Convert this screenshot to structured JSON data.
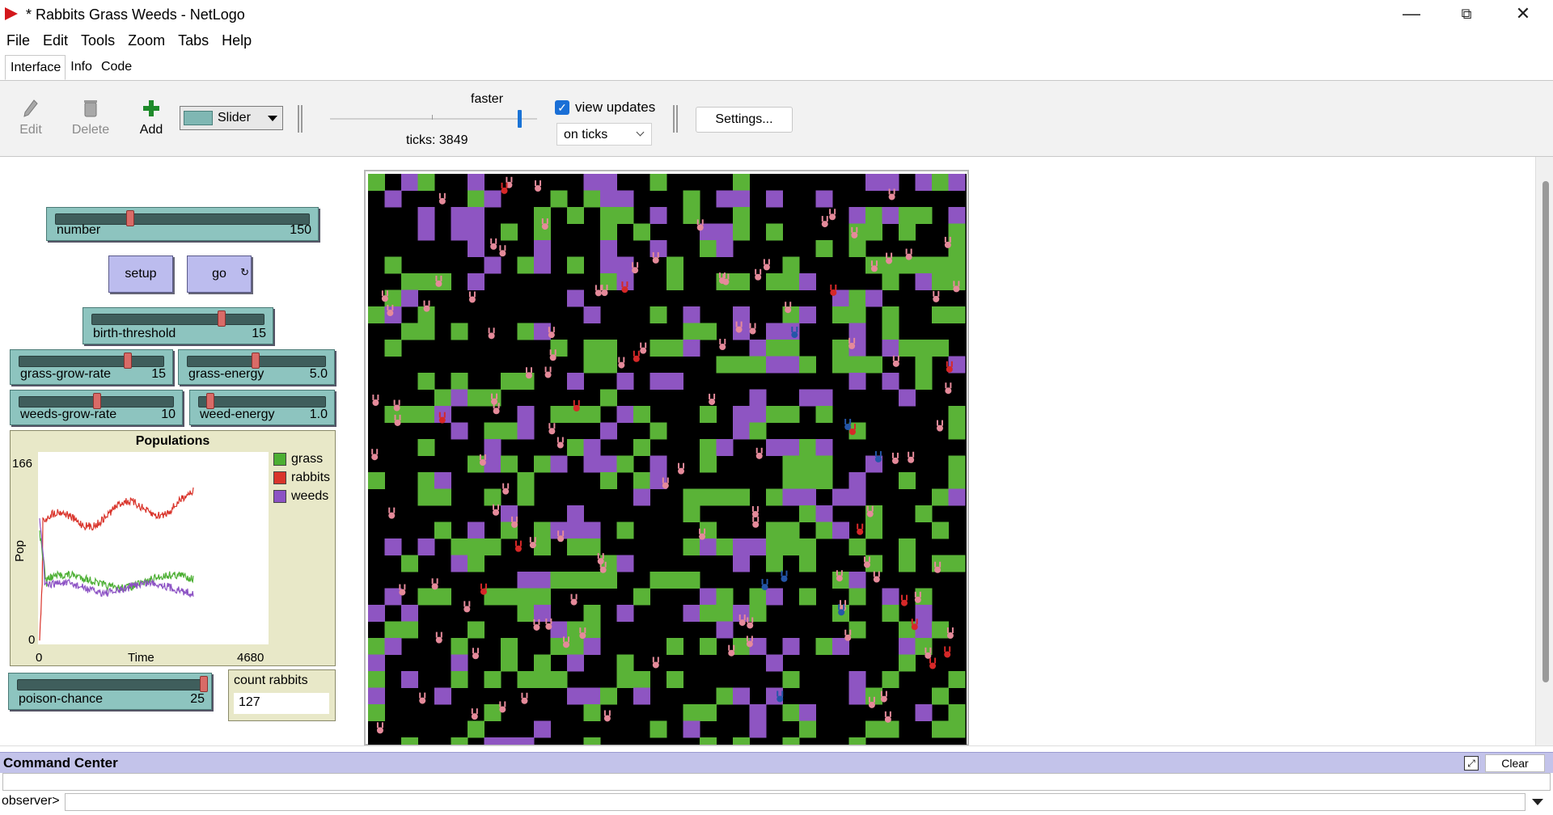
{
  "window": {
    "title": "* Rabbits Grass Weeds - NetLogo"
  },
  "menu": [
    "File",
    "Edit",
    "Tools",
    "Zoom",
    "Tabs",
    "Help"
  ],
  "tabs": [
    "Interface",
    "Info",
    "Code"
  ],
  "toolbar": {
    "edit_label": "Edit",
    "delete_label": "Delete",
    "add_label": "Add",
    "widget_type": "Slider",
    "speed_label": "faster",
    "ticks_label": "ticks: 3849",
    "view_updates_label": "view updates",
    "view_updates_checked": true,
    "update_mode": "on ticks",
    "settings_label": "Settings..."
  },
  "widgets": {
    "number": {
      "label": "number",
      "value": "150"
    },
    "setup_label": "setup",
    "go_label": "go",
    "birth_threshold": {
      "label": "birth-threshold",
      "value": "15"
    },
    "grass_grow_rate": {
      "label": "grass-grow-rate",
      "value": "15"
    },
    "grass_energy": {
      "label": "grass-energy",
      "value": "5.0"
    },
    "weeds_grow_rate": {
      "label": "weeds-grow-rate",
      "value": "10"
    },
    "weed_energy": {
      "label": "weed-energy",
      "value": "1.0"
    },
    "poison_chance": {
      "label": "poison-chance",
      "value": "25"
    },
    "monitor": {
      "label": "count rabbits",
      "value": "127"
    }
  },
  "plot": {
    "title": "Populations",
    "xlabel": "Time",
    "ylabel": "Pop",
    "xmin": "0",
    "xmax": "4680",
    "ymin": "0",
    "ymax": "166",
    "legend": [
      {
        "name": "grass",
        "color": "#4caf33"
      },
      {
        "name": "rabbits",
        "color": "#d9342b"
      },
      {
        "name": "weeds",
        "color": "#8c52c4"
      }
    ]
  },
  "command_center": {
    "title": "Command Center",
    "clear_label": "Clear",
    "prompt": "observer>"
  },
  "colors": {
    "grass": "#5ab337",
    "weeds": "#8e55c2",
    "rabbit_pink": "#e58a9a",
    "rabbit_red": "#d62828",
    "rabbit_blue": "#2456a8"
  }
}
